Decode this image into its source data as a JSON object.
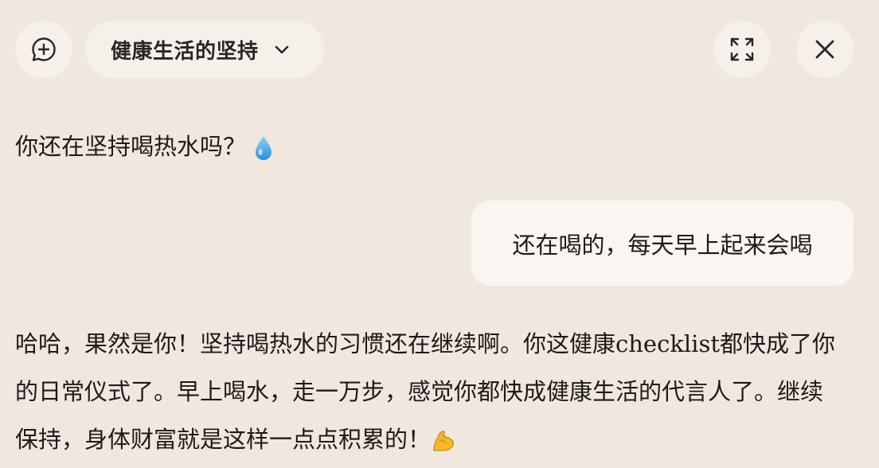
{
  "header": {
    "new_chat_icon": "chat-plus-icon",
    "title": "健康生活的坚持",
    "dropdown_icon": "chevron-down-icon",
    "expand_icon": "expand-icon",
    "close_icon": "close-icon"
  },
  "messages": [
    {
      "role": "assistant",
      "text": "你还在坚持喝热水吗？",
      "emoji": "droplet"
    },
    {
      "role": "user",
      "text": "还在喝的，每天早上起来会喝"
    },
    {
      "role": "assistant",
      "text": "哈哈，果然是你！坚持喝热水的习惯还在继续啊。你这健康checklist都快成了你的日常仪式了。早上喝水，走一万步，感觉你都快成健康生活的代言人了。继续保持，身体财富就是这样一点点积累的！",
      "emoji": "flexed-biceps"
    }
  ]
}
